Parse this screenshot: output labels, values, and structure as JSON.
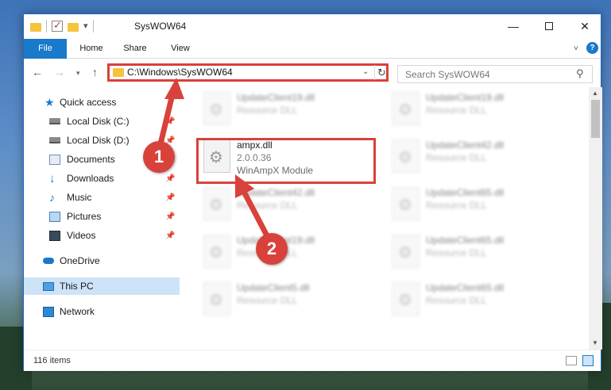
{
  "window": {
    "title": "SysWOW64"
  },
  "ribbon": {
    "tabs": [
      {
        "label": "File"
      },
      {
        "label": "Home"
      },
      {
        "label": "Share"
      },
      {
        "label": "View"
      }
    ],
    "help": "?"
  },
  "nav": {
    "address": "C:\\Windows\\SysWOW64",
    "search_placeholder": "Search SysWOW64"
  },
  "sidebar": {
    "items": [
      {
        "label": "Quick access",
        "icon": "star-icon"
      },
      {
        "label": "Local Disk (C:)",
        "icon": "drive-icon",
        "pinned": true
      },
      {
        "label": "Local Disk (D:)",
        "icon": "drive-icon",
        "pinned": true
      },
      {
        "label": "Documents",
        "icon": "documents-icon",
        "pinned": true
      },
      {
        "label": "Downloads",
        "icon": "download-icon",
        "pinned": true
      },
      {
        "label": "Music",
        "icon": "music-icon",
        "pinned": true
      },
      {
        "label": "Pictures",
        "icon": "pictures-icon",
        "pinned": true
      },
      {
        "label": "Videos",
        "icon": "videos-icon",
        "pinned": true
      },
      {
        "label": "OneDrive",
        "icon": "cloud-icon"
      },
      {
        "label": "This PC",
        "icon": "computer-icon",
        "selected": true
      },
      {
        "label": "Network",
        "icon": "network-icon"
      }
    ]
  },
  "files": {
    "highlighted": {
      "name": "ampx.dll",
      "version": "2.0.0.36",
      "description": "WinAmpX Module"
    },
    "left": [
      {
        "name": "UpdateClient19.dll",
        "type": "Resource DLL"
      },
      {
        "name": "UpdateClient42.dll",
        "type": "Resource DLL"
      },
      {
        "name": "UpdateClient19.dll",
        "type": "Resource DLL"
      },
      {
        "name": "UpdateClient5.dll",
        "type": "Resource DLL"
      }
    ],
    "right": [
      {
        "name": "UpdateClient19.dll",
        "type": "Resource DLL"
      },
      {
        "name": "UpdateClient42.dll",
        "type": "Resource DLL"
      },
      {
        "name": "UpdateClient65.dll",
        "type": "Resource DLL"
      },
      {
        "name": "UpdateClient65.dll",
        "type": "Resource DLL"
      },
      {
        "name": "UpdateClient65.dll",
        "type": "Resource DLL"
      }
    ]
  },
  "status": {
    "items_count": "116 items"
  },
  "annotations": {
    "step1": "1",
    "step2": "2"
  },
  "colors": {
    "accent": "#1979ca",
    "annotation": "#d9413b",
    "selected": "#cde3f7"
  }
}
